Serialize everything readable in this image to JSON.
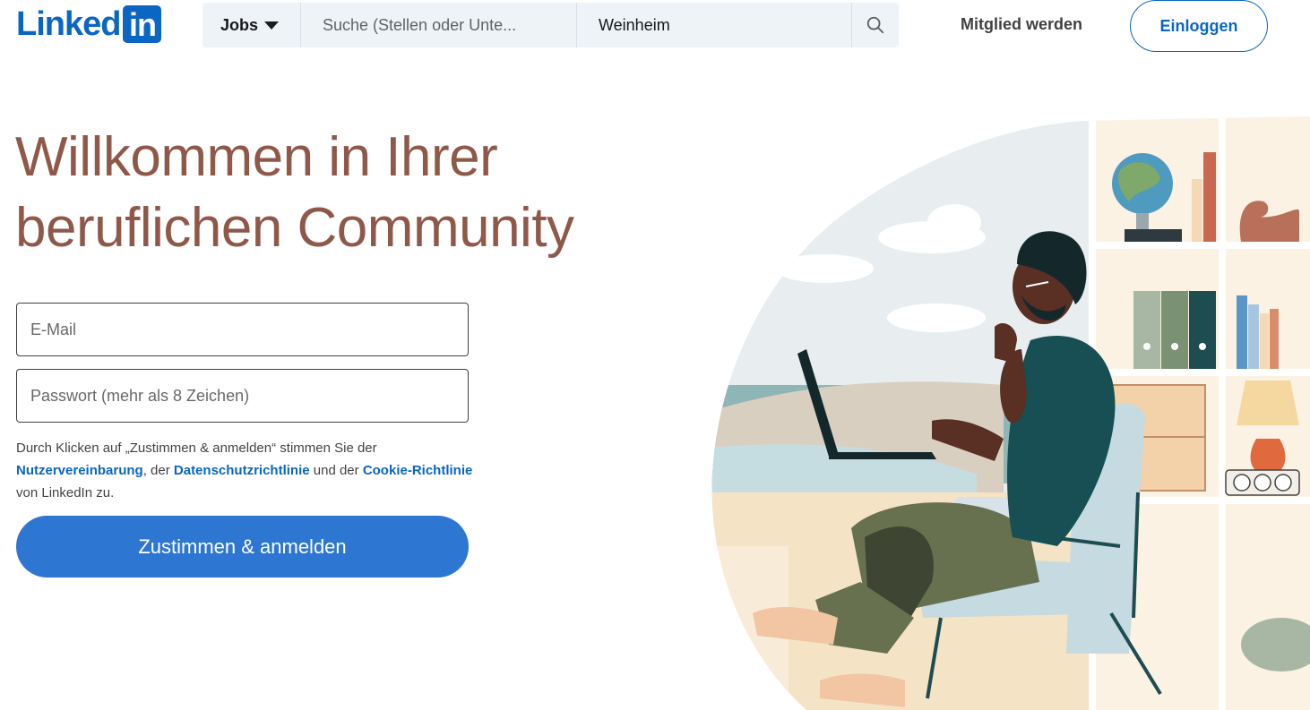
{
  "header": {
    "logo_text": "Linked",
    "logo_box_text": "in",
    "jobs_label": "Jobs",
    "search_placeholder": "Suche (Stellen oder Unte...",
    "location_value": "Weinheim",
    "join_label": "Mitglied werden",
    "signin_label": "Einloggen"
  },
  "hero": {
    "title_line1": "Willkommen in Ihrer",
    "title_line2": "beruflichen Community"
  },
  "form": {
    "email_placeholder": "E-Mail",
    "password_placeholder": "Passwort (mehr als 8 Zeichen)",
    "terms_prefix": "Durch Klicken auf „Zustimmen & anmelden“ stimmen Sie der ",
    "terms_link1": "Nutzervereinbarung",
    "terms_mid1": ", der ",
    "terms_link2": "Datenschutzrichtlinie",
    "terms_mid2": " und der ",
    "terms_link3": "Cookie-Richtlinie",
    "terms_suffix": " von LinkedIn zu.",
    "submit_label": "Zustimmen & anmelden"
  },
  "colors": {
    "brand": "#0a66c2",
    "headline": "#8f5849",
    "button": "#2d77d2"
  },
  "icons": {
    "search": "search-icon",
    "dropdown": "caret-down-icon"
  }
}
